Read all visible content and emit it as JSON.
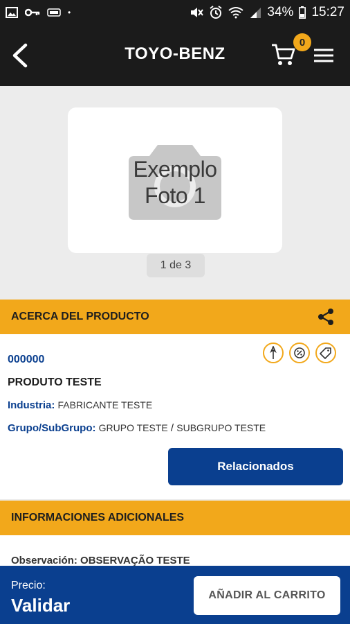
{
  "status_bar": {
    "battery": "34%",
    "time": "15:27",
    "icons": [
      "gallery-icon",
      "key-icon",
      "vpn-icon",
      "dot-icon",
      "mute-icon",
      "alarm-icon",
      "wifi-icon",
      "signal-icon",
      "battery-icon"
    ]
  },
  "app_bar": {
    "title": "TOYO-BENZ",
    "cart_count": "0",
    "icons": [
      "back-arrow-icon",
      "cart-icon",
      "hamburger-menu-icon"
    ]
  },
  "gallery": {
    "photo_text_line1": "Exemplo",
    "photo_text_line2": "Foto 1",
    "pager": "1 de 3"
  },
  "about": {
    "header": "ACERCA DEL PRODUCTO",
    "code": "000000",
    "name": "PRODUTO TESTE",
    "industry_label": "Industria:",
    "industry_value": "FABRICANTE TESTE",
    "group_label": "Grupo/SubGrupo:",
    "group_value": "GRUPO TESTE",
    "group_sep": "/",
    "subgroup_value": "SUBGRUPO TESTE",
    "related_button": "Relacionados",
    "badge_icons": [
      "pin-badge-icon",
      "percent-badge-icon",
      "tag-badge-icon"
    ]
  },
  "extra": {
    "header": "INFORMACIONES ADICIONALES",
    "obs_label": "Observación:",
    "obs_value": "OBSERVAÇÃO TESTE"
  },
  "footer": {
    "price_label": "Precio:",
    "price_value": "Validar",
    "add_button": "AÑADIR AL CARRITO"
  },
  "colors": {
    "accent": "#f2a81b",
    "primary": "#0a3f8f",
    "app_bar": "#1b1b1b"
  }
}
